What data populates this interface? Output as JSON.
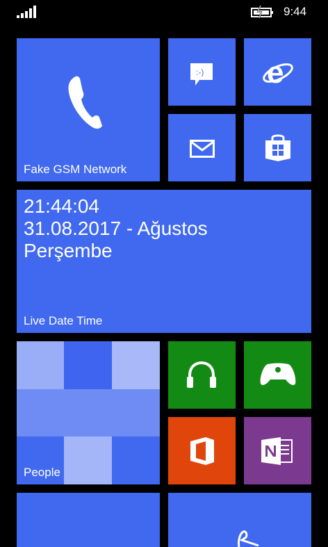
{
  "status": {
    "time": "9:44",
    "signal_icon": "signal-bars-icon",
    "battery_icon": "battery-charging-icon"
  },
  "tiles": {
    "phone": {
      "label": "Fake GSM Network",
      "icon": "phone-icon",
      "color": "#4069F0"
    },
    "messaging": {
      "icon": "messaging-icon",
      "color": "#4069F0"
    },
    "ie": {
      "icon": "internet-explorer-icon",
      "color": "#4069F0"
    },
    "mail": {
      "icon": "mail-icon",
      "color": "#4069F0"
    },
    "store": {
      "icon": "store-icon",
      "color": "#4069F0"
    },
    "datetime": {
      "time": "21:44:04",
      "date": "31.08.2017 - Ağustos",
      "day": "Perşembe",
      "label": "Live Date Time",
      "color": "#4069F0"
    },
    "people": {
      "label": "People",
      "color": "#4069F0"
    },
    "music": {
      "icon": "headphones-icon",
      "color": "#138A13"
    },
    "games": {
      "icon": "xbox-controller-icon",
      "color": "#138A13"
    },
    "office": {
      "icon": "office-icon",
      "color": "#E0460C"
    },
    "onenote": {
      "icon": "onenote-icon",
      "color": "#7B3A8F"
    },
    "bottom_left": {
      "color": "#4069F0"
    },
    "bottom_right": {
      "icon": "partial-tile-icon",
      "color": "#4069F0"
    }
  }
}
